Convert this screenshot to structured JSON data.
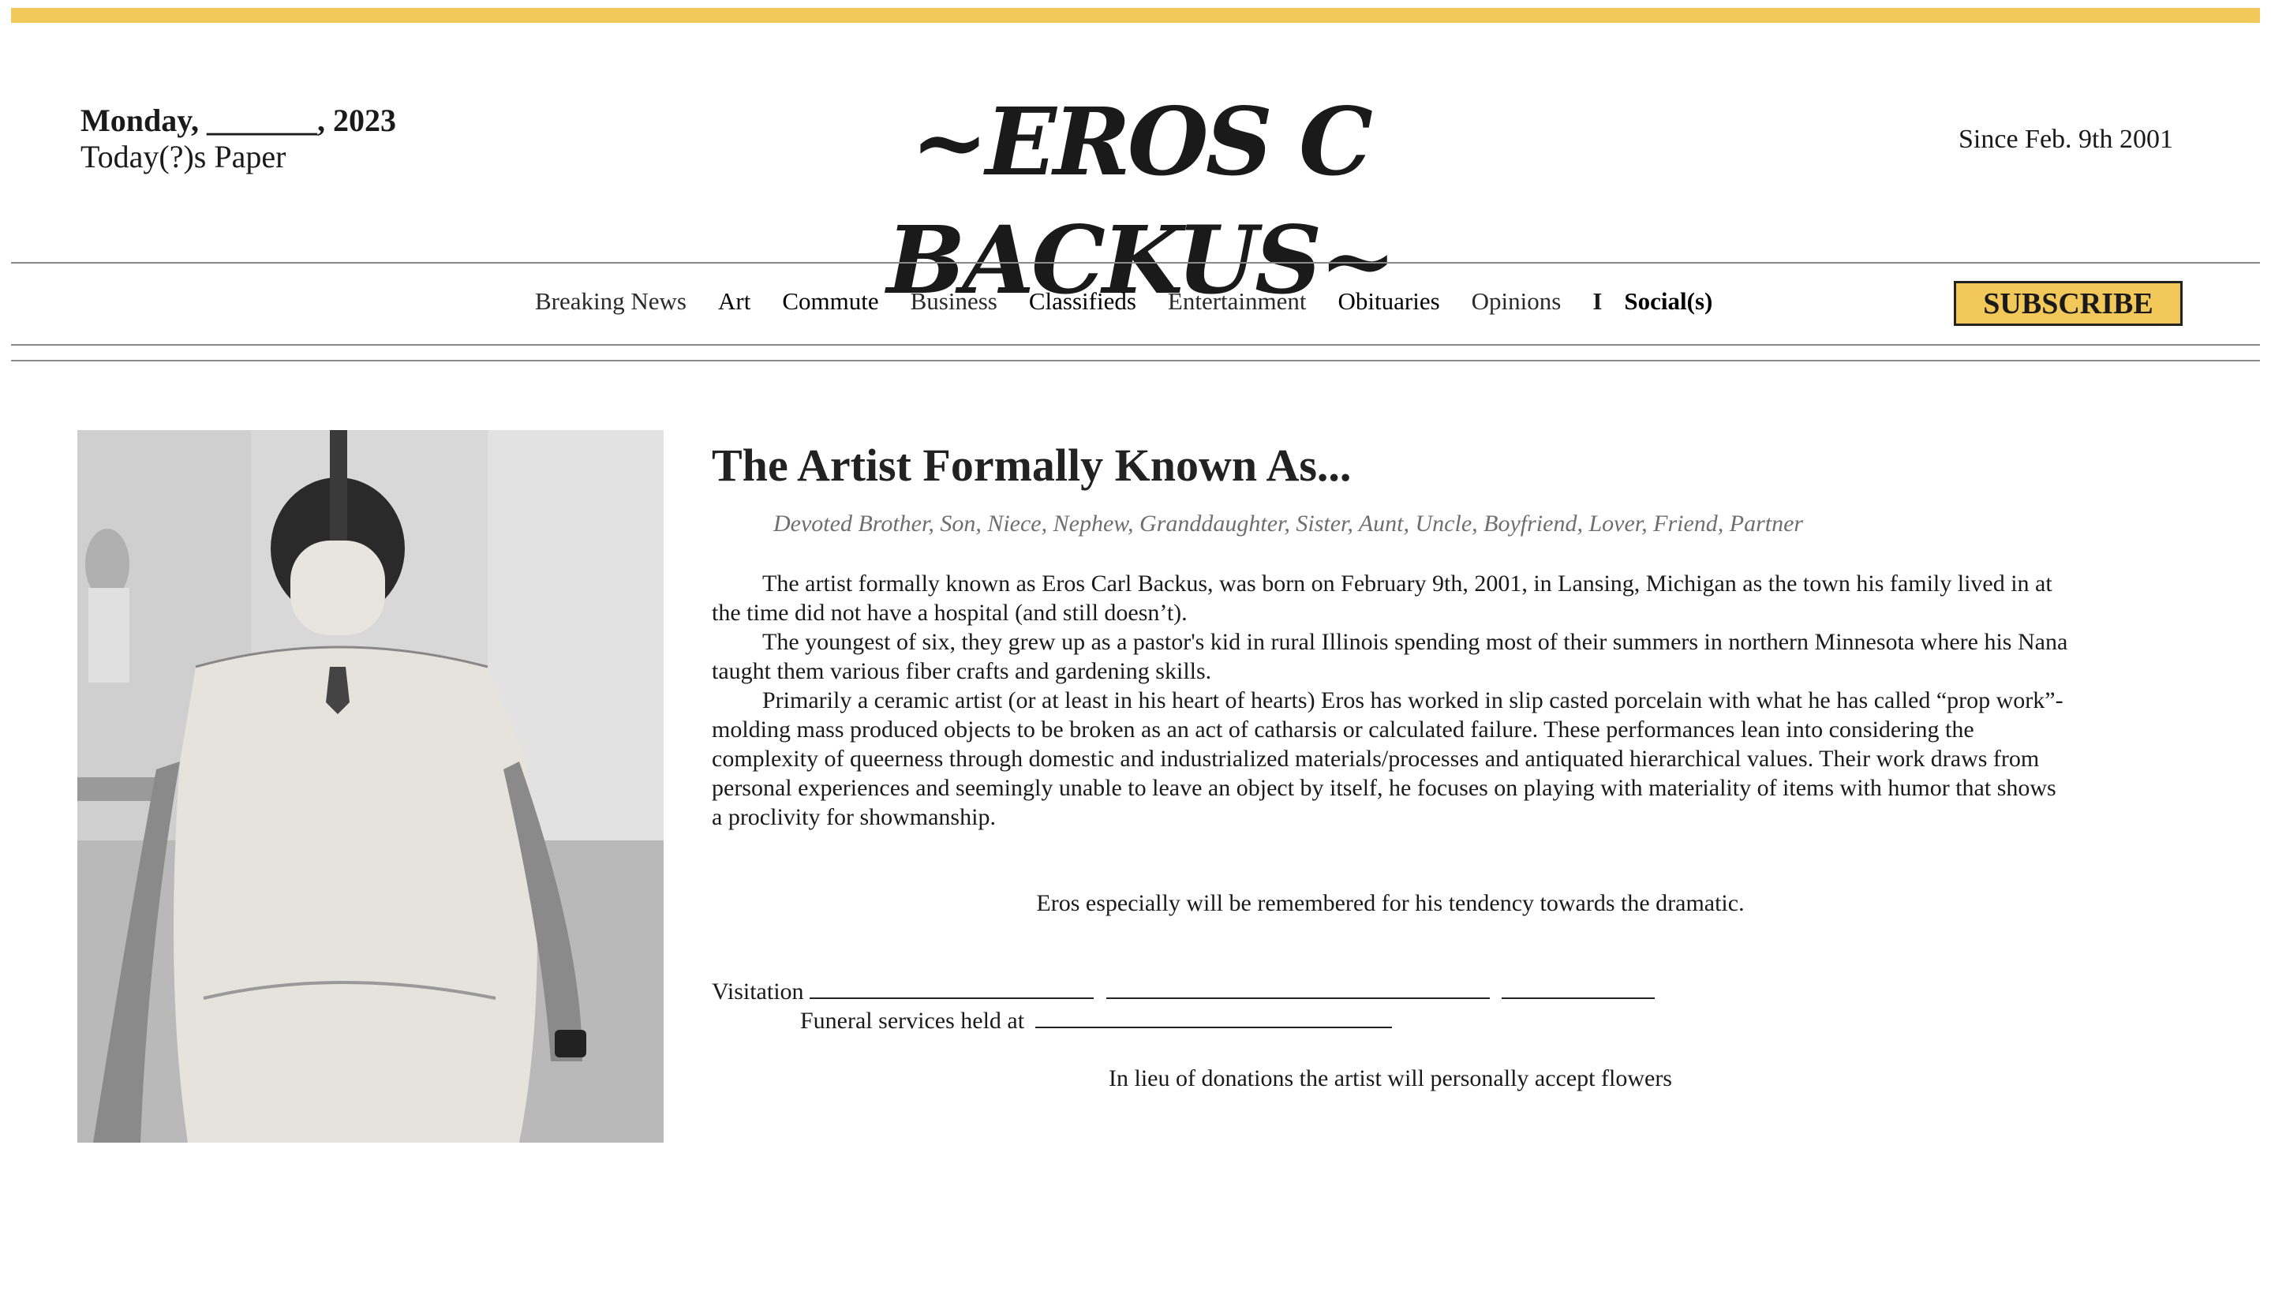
{
  "header": {
    "date_line": "Monday, _______, 2023",
    "subtitle": "Today(?)s Paper",
    "masthead": "~EROS C BACKUS~",
    "since": "Since Feb. 9th 2001"
  },
  "nav": {
    "items": [
      "Breaking News",
      "Art",
      "Commute",
      "Business",
      "Classifieds",
      "Entertainment",
      "Obituaries",
      "Opinions"
    ],
    "separator": "I",
    "socials": "Social(s)",
    "subscribe": "SUBSCRIBE"
  },
  "colors": {
    "accent": "#f2c85a"
  },
  "article": {
    "headline": "The Artist Formally Known As...",
    "tagline": "Devoted Brother, Son, Niece, Nephew, Granddaughter, Sister, Aunt, Uncle, Boyfriend, Lover, Friend, Partner",
    "paragraphs": [
      "The artist formally known as Eros Carl Backus, was born on February 9th, 2001, in Lansing, Michigan as the town his family lived in at the time did not have a hospital (and still doesn’t).",
      "The youngest of six, they grew up as a pastor's kid in rural Illinois spending most of their summers in northern Minnesota where his Nana taught them various fiber crafts and gardening skills.",
      "Primarily a ceramic artist (or at least in his heart of hearts) Eros has worked in slip casted porcelain with what he has called “prop work”-molding mass produced objects to be broken as an act of catharsis or calculated failure. These performances lean into considering the complexity of queerness through domestic and industrialized materials/processes and antiquated hierarchical values. Their work draws from personal experiences and seemingly unable to leave an object by itself, he focuses on playing with materiality of items with humor that shows a proclivity for showmanship."
    ],
    "remember": "Eros especially will be remembered for his tendency towards the dramatic.",
    "visitation_label": "Visitation",
    "funeral_label": "Funeral services held at",
    "lieu": "In lieu of donations the artist will personally accept flowers"
  }
}
